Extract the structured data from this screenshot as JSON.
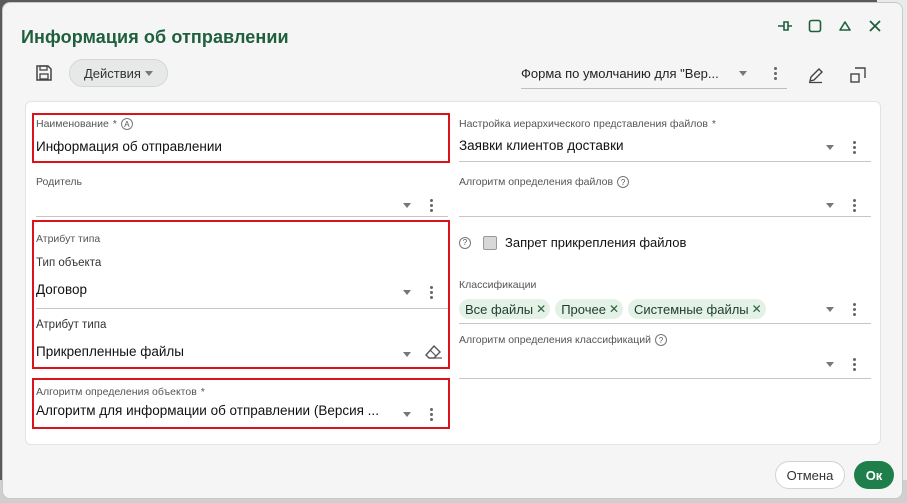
{
  "dialog": {
    "title": "Информация об отправлении",
    "window_controls": [
      "pin-icon",
      "maximize-icon",
      "collapse-icon",
      "close-icon"
    ]
  },
  "toolbar": {
    "actions_label": "Действия",
    "form_select": "Форма по умолчанию для \"Вер..."
  },
  "left": {
    "name": {
      "label": "Наименование",
      "required": "*",
      "value": "Информация об отправлении"
    },
    "parent": {
      "label": "Родитель",
      "value": ""
    },
    "type_attr_group": {
      "label": "Атрибут типа",
      "object_type": {
        "label": "Тип объекта",
        "value": "Договор"
      },
      "type_attr": {
        "label": "Атрибут типа",
        "value": "Прикрепленные файлы"
      }
    },
    "object_algo": {
      "label": "Алгоритм определения объектов",
      "required": "*",
      "value": "Алгоритм для информации об отправлении (Версия ..."
    }
  },
  "right": {
    "hier_setting": {
      "label": "Настройка иерархического представления файлов",
      "required": "*",
      "value": "Заявки клиентов доставки"
    },
    "file_algo": {
      "label": "Алгоритм определения файлов",
      "value": ""
    },
    "forbid_attach": {
      "label": "Запрет прикрепления файлов"
    },
    "classifications": {
      "label": "Классификации",
      "chips": [
        "Все файлы",
        "Прочее",
        "Системные файлы"
      ]
    },
    "class_algo": {
      "label": "Алгоритм определения классификаций",
      "value": ""
    }
  },
  "footer": {
    "cancel_label": "Отмена",
    "ok_label": "Ок"
  },
  "colors": {
    "accent": "#1f5f3d",
    "ok_button": "#1f7f4a",
    "highlight": "#d9151b",
    "chip_bg": "#e3f1e6"
  }
}
